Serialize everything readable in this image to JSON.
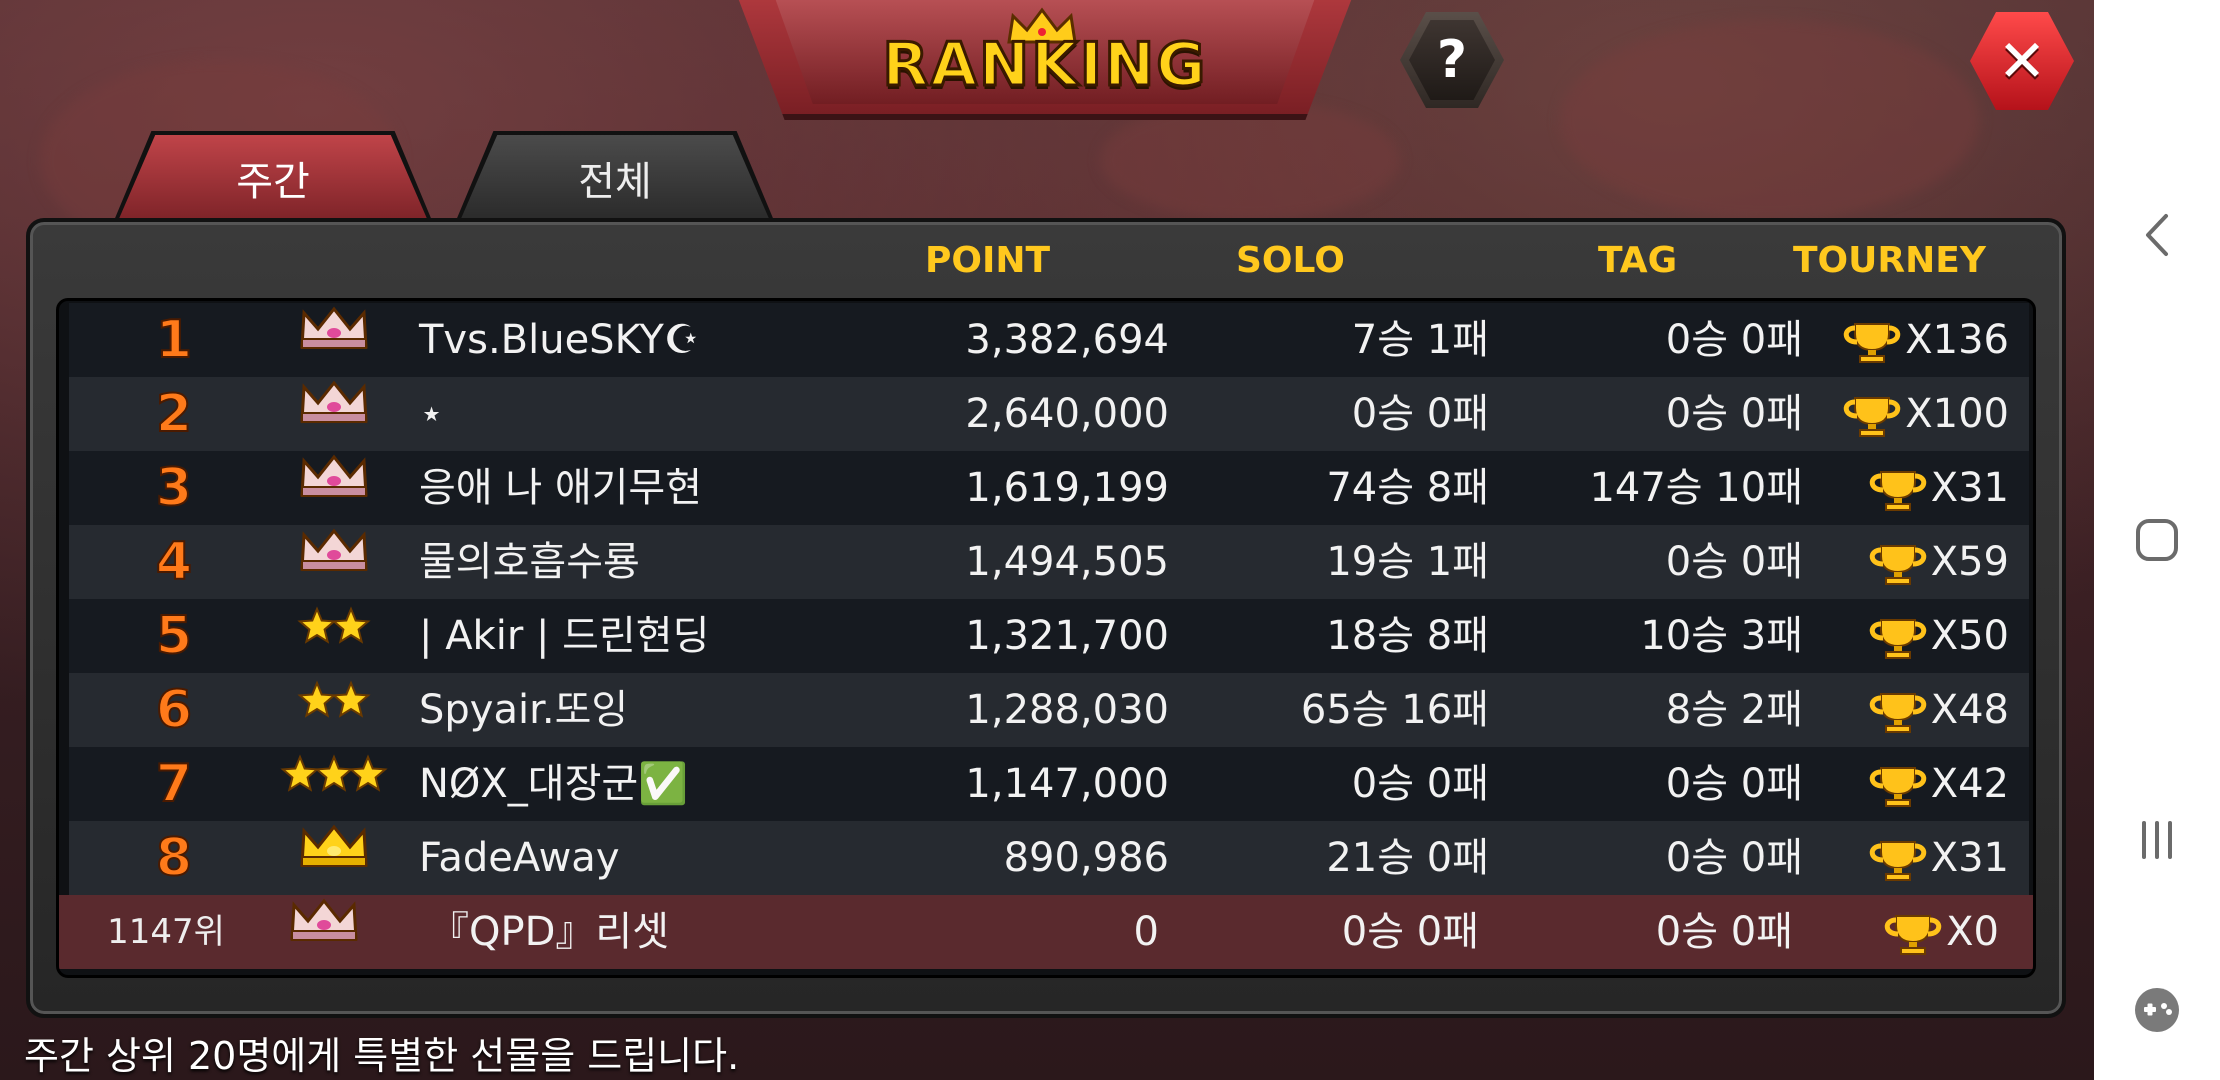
{
  "title": "RANKING",
  "buttons": {
    "help": "?",
    "close": "✕"
  },
  "tabs": [
    {
      "label": "주간",
      "active": true
    },
    {
      "label": "전체",
      "active": false
    }
  ],
  "columns": {
    "point": "POINT",
    "solo": "SOLO",
    "tag": "TAG",
    "tourney": "TOURNEY"
  },
  "rows": [
    {
      "rank": "1",
      "badge": "crown-pink",
      "name": "Tvs.BlueSKY☪",
      "point": "3,382,694",
      "solo": "7승 1패",
      "tag": "0승 0패",
      "tourney": "X136"
    },
    {
      "rank": "2",
      "badge": "crown-pink",
      "name": "⋆",
      "point": "2,640,000",
      "solo": "0승 0패",
      "tag": "0승 0패",
      "tourney": "X100"
    },
    {
      "rank": "3",
      "badge": "crown-pink",
      "name": "응애 나 애기무현",
      "point": "1,619,199",
      "solo": "74승 8패",
      "tag": "147승 10패",
      "tourney": "X31"
    },
    {
      "rank": "4",
      "badge": "crown-pink",
      "name": "물의호흡수룡",
      "point": "1,494,505",
      "solo": "19승 1패",
      "tag": "0승 0패",
      "tourney": "X59"
    },
    {
      "rank": "5",
      "badge": "two-stars",
      "name": "| Akir | 드린현딩",
      "point": "1,321,700",
      "solo": "18승 8패",
      "tag": "10승 3패",
      "tourney": "X50"
    },
    {
      "rank": "6",
      "badge": "two-stars",
      "name": "Spyair.또잉",
      "point": "1,288,030",
      "solo": "65승 16패",
      "tag": "8승 2패",
      "tourney": "X48"
    },
    {
      "rank": "7",
      "badge": "three-stars",
      "name": "NØX_대장군✅",
      "point": "1,147,000",
      "solo": "0승 0패",
      "tag": "0승 0패",
      "tourney": "X42"
    },
    {
      "rank": "8",
      "badge": "crown-gold",
      "name": "FadeAway",
      "point": "890,986",
      "solo": "21승 0패",
      "tag": "0승 0패",
      "tourney": "X31"
    }
  ],
  "my_row": {
    "rank": "1147위",
    "badge": "crown-pink",
    "name": "『QPD』리셋",
    "point": "0",
    "solo": "0승 0패",
    "tag": "0승 0패",
    "tourney": "X0"
  },
  "footer": "주간 상위 20명에게 특별한 선물을 드립니다.",
  "colors": {
    "accent_gold": "#ffc81e",
    "rank_orange": "#ff7a1a",
    "tab_red": "#c04449",
    "highlight_row": "#5a2a2e"
  },
  "navbar_icons": [
    "back-icon",
    "home-icon",
    "recents-icon",
    "game-tools-icon"
  ]
}
